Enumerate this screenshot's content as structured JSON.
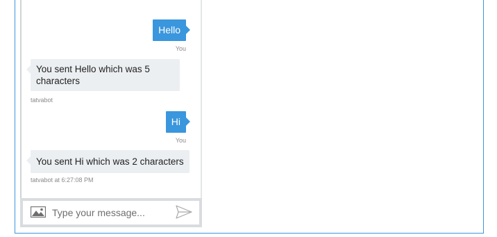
{
  "messages": [
    {
      "from": "user",
      "text": "Hello",
      "meta": "You"
    },
    {
      "from": "bot",
      "text": "You sent Hello which was 5 characters",
      "meta": "tatvabot"
    },
    {
      "from": "user",
      "text": "Hi",
      "meta": "You"
    },
    {
      "from": "bot",
      "text": "You sent Hi which was 2 characters",
      "meta": "tatvabot at 6:27:08 PM"
    }
  ],
  "composer": {
    "placeholder": "Type your message...",
    "image_icon": "image-icon",
    "send_icon": "send-icon"
  },
  "colors": {
    "accent": "#3a96dd",
    "bot_bubble": "#eceff1"
  }
}
